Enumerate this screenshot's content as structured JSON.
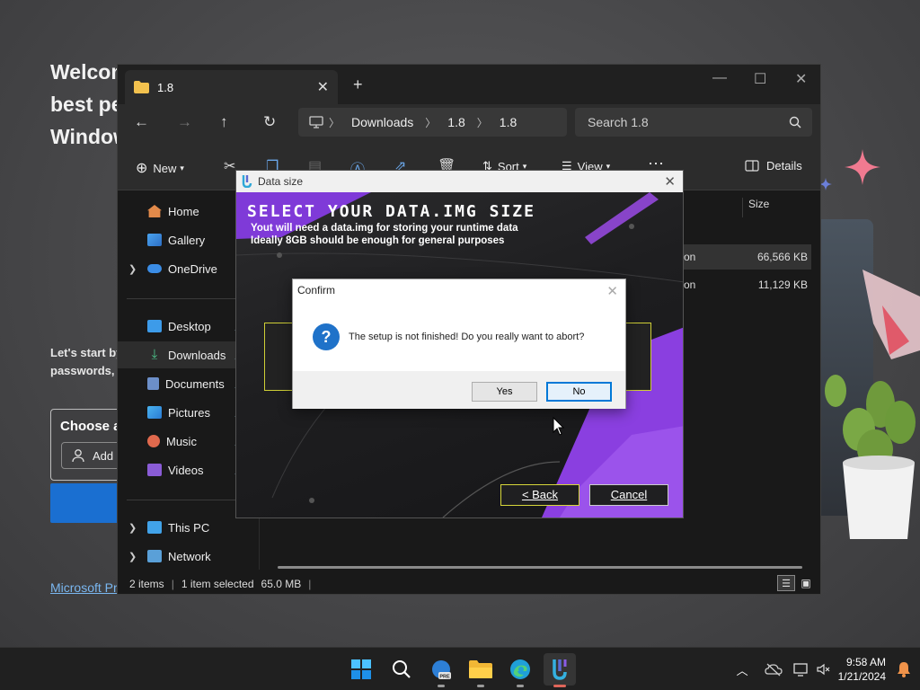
{
  "background": {
    "welcome_title": "Welcome to Microsoft Edge, the best performing browser on Windows",
    "welcome_desc": "Let's start by bringing over your passwords,",
    "choose_label": "Choose a",
    "add_label": "Add",
    "link_text": "Microsoft Pr"
  },
  "explorer": {
    "tab_title": "1.8",
    "breadcrumb": [
      "Downloads",
      "1.8",
      "1.8"
    ],
    "search_placeholder": "Search 1.8",
    "toolbar": {
      "new": "New",
      "sort": "Sort",
      "view": "View",
      "details": "Details"
    },
    "nav": {
      "home": "Home",
      "gallery": "Gallery",
      "onedrive": "OneDrive",
      "desktop": "Desktop",
      "downloads": "Downloads",
      "documents": "Documents",
      "pictures": "Pictures",
      "music": "Music",
      "videos": "Videos",
      "thispc": "This PC",
      "network": "Network"
    },
    "columns": {
      "size": "Size"
    },
    "files": [
      {
        "type_fragment": "on",
        "size": "66,566 KB"
      },
      {
        "type_fragment": "on",
        "size": "11,129 KB"
      }
    ],
    "status": {
      "items": "2 items",
      "selected": "1 item selected",
      "size": "65.0 MB"
    }
  },
  "setup": {
    "title": "Data size",
    "heading": "SELECT YOUR DATA.IMG SIZE",
    "line1": "Yout will need a data.img for storing your runtime data",
    "line2": "Ideally 8GB should be enough for general purposes",
    "back_label": "< Back",
    "cancel_label": "Cancel"
  },
  "confirm": {
    "title": "Confirm",
    "message": "The setup is not finished! Do you really want to abort?",
    "yes_label": "Yes",
    "no_label": "No"
  },
  "taskbar": {
    "time": "9:58 AM",
    "date": "1/21/2024",
    "apps": [
      "start-icon",
      "search-icon",
      "edge-beta-icon",
      "file-explorer-icon",
      "edge-icon",
      "setup-app-icon"
    ]
  },
  "colors": {
    "accent": "#0078d7",
    "setup_purple": "#8a3fe0",
    "setup_yellow": "#d7d73a"
  }
}
